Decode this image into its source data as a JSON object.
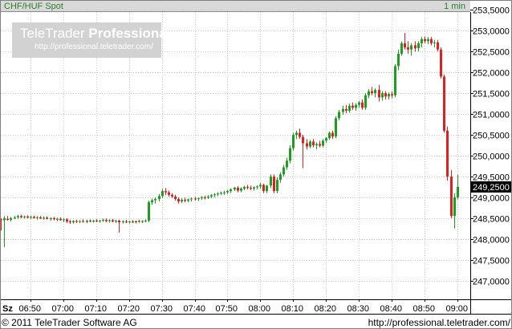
{
  "header": {
    "instrument": "CHF/HUF Spot",
    "interval": "1 min"
  },
  "watermark": {
    "brand_light": "TeleTrader",
    "brand_bold": "Professional",
    "url": "http://professional.teletrader.com/"
  },
  "footer": {
    "copyright": "© 2011 TeleTrader Software AG",
    "url": "http://professional.teletrader.com/"
  },
  "chart_data": {
    "type": "candlestick",
    "title": "CHF/HUF Spot",
    "interval": "1 min",
    "xlabel": "Sz",
    "ylabel": "",
    "ylim": [
      246.55,
      253.45
    ],
    "xlim": [
      "06:38",
      "09:02"
    ],
    "grid": true,
    "x_ticks": [
      "06:50",
      "07:00",
      "07:10",
      "07:20",
      "07:30",
      "07:40",
      "07:50",
      "08:00",
      "08:10",
      "08:20",
      "08:30",
      "08:40",
      "08:50",
      "09:00"
    ],
    "y_ticks": [
      "253,5000",
      "253,0000",
      "252,5000",
      "252,0000",
      "251,5000",
      "251,0000",
      "250,5000",
      "250,0000",
      "249,5000",
      "249,0000",
      "248,5000",
      "248,0000",
      "247,5000",
      "247,0000"
    ],
    "y_tick_values": [
      253.5,
      253.0,
      252.5,
      252.0,
      251.5,
      251.0,
      250.5,
      250.0,
      249.5,
      249.0,
      248.5,
      248.0,
      247.5,
      247.0
    ],
    "last_price": "249,2500",
    "last_price_value": 249.25,
    "up_color": "#1e9e1e",
    "down_color": "#e02020",
    "last_price_box_color": "#000000",
    "candles": [
      {
        "t": "06:38",
        "o": 248.55,
        "h": 248.6,
        "l": 248.5,
        "c": 248.53
      },
      {
        "t": "06:39",
        "o": 248.53,
        "h": 248.56,
        "l": 248.48,
        "c": 248.5
      },
      {
        "t": "06:40",
        "o": 248.5,
        "h": 248.55,
        "l": 248.46,
        "c": 248.47
      },
      {
        "t": "06:41",
        "o": 248.47,
        "h": 248.5,
        "l": 248.2,
        "c": 248.45
      },
      {
        "t": "06:42",
        "o": 248.45,
        "h": 248.55,
        "l": 247.8,
        "c": 248.5
      },
      {
        "t": "06:43",
        "o": 248.48,
        "h": 248.55,
        "l": 248.44,
        "c": 248.46
      },
      {
        "t": "06:44",
        "o": 248.46,
        "h": 248.53,
        "l": 248.42,
        "c": 248.5
      },
      {
        "t": "06:45",
        "o": 248.5,
        "h": 248.55,
        "l": 248.47,
        "c": 248.52
      },
      {
        "t": "06:46",
        "o": 248.52,
        "h": 248.58,
        "l": 248.48,
        "c": 248.55
      },
      {
        "t": "06:47",
        "o": 248.55,
        "h": 248.58,
        "l": 248.5,
        "c": 248.52
      },
      {
        "t": "06:48",
        "o": 248.52,
        "h": 248.56,
        "l": 248.49,
        "c": 248.54
      },
      {
        "t": "06:49",
        "o": 248.54,
        "h": 248.57,
        "l": 248.5,
        "c": 248.51
      },
      {
        "t": "06:50",
        "o": 248.51,
        "h": 248.56,
        "l": 248.48,
        "c": 248.53
      },
      {
        "t": "06:51",
        "o": 248.53,
        "h": 248.56,
        "l": 248.49,
        "c": 248.5
      },
      {
        "t": "06:52",
        "o": 248.5,
        "h": 248.55,
        "l": 248.46,
        "c": 248.52
      },
      {
        "t": "06:53",
        "o": 248.52,
        "h": 248.55,
        "l": 248.48,
        "c": 248.49
      },
      {
        "t": "06:54",
        "o": 248.49,
        "h": 248.54,
        "l": 248.46,
        "c": 248.51
      },
      {
        "t": "06:55",
        "o": 248.51,
        "h": 248.54,
        "l": 248.47,
        "c": 248.48
      },
      {
        "t": "06:56",
        "o": 248.48,
        "h": 248.52,
        "l": 248.44,
        "c": 248.5
      },
      {
        "t": "06:57",
        "o": 248.5,
        "h": 248.53,
        "l": 248.45,
        "c": 248.47
      },
      {
        "t": "06:58",
        "o": 248.47,
        "h": 248.51,
        "l": 248.43,
        "c": 248.48
      },
      {
        "t": "06:59",
        "o": 248.48,
        "h": 248.52,
        "l": 248.44,
        "c": 248.45
      },
      {
        "t": "07:00",
        "o": 248.45,
        "h": 248.5,
        "l": 248.4,
        "c": 248.47
      },
      {
        "t": "07:01",
        "o": 248.47,
        "h": 248.5,
        "l": 248.38,
        "c": 248.42
      },
      {
        "t": "07:02",
        "o": 248.42,
        "h": 248.46,
        "l": 248.36,
        "c": 248.4
      },
      {
        "t": "07:03",
        "o": 248.4,
        "h": 248.45,
        "l": 248.37,
        "c": 248.43
      },
      {
        "t": "07:04",
        "o": 248.43,
        "h": 248.46,
        "l": 248.38,
        "c": 248.41
      },
      {
        "t": "07:05",
        "o": 248.41,
        "h": 248.45,
        "l": 248.38,
        "c": 248.43
      },
      {
        "t": "07:06",
        "o": 248.43,
        "h": 248.47,
        "l": 248.39,
        "c": 248.41
      },
      {
        "t": "07:07",
        "o": 248.41,
        "h": 248.46,
        "l": 248.38,
        "c": 248.44
      },
      {
        "t": "07:08",
        "o": 248.44,
        "h": 248.47,
        "l": 248.4,
        "c": 248.42
      },
      {
        "t": "07:09",
        "o": 248.42,
        "h": 248.46,
        "l": 248.39,
        "c": 248.44
      },
      {
        "t": "07:10",
        "o": 248.44,
        "h": 248.48,
        "l": 248.4,
        "c": 248.42
      },
      {
        "t": "07:11",
        "o": 248.42,
        "h": 248.46,
        "l": 248.39,
        "c": 248.44
      },
      {
        "t": "07:12",
        "o": 248.44,
        "h": 248.49,
        "l": 248.41,
        "c": 248.46
      },
      {
        "t": "07:13",
        "o": 248.46,
        "h": 248.49,
        "l": 248.4,
        "c": 248.43
      },
      {
        "t": "07:14",
        "o": 248.43,
        "h": 248.47,
        "l": 248.39,
        "c": 248.45
      },
      {
        "t": "07:15",
        "o": 248.45,
        "h": 248.48,
        "l": 248.4,
        "c": 248.42
      },
      {
        "t": "07:16",
        "o": 248.42,
        "h": 248.46,
        "l": 248.38,
        "c": 248.44
      },
      {
        "t": "07:17",
        "o": 248.44,
        "h": 248.46,
        "l": 248.15,
        "c": 248.4
      },
      {
        "t": "07:18",
        "o": 248.4,
        "h": 248.45,
        "l": 248.37,
        "c": 248.42
      },
      {
        "t": "07:19",
        "o": 248.42,
        "h": 248.46,
        "l": 248.38,
        "c": 248.4
      },
      {
        "t": "07:20",
        "o": 248.4,
        "h": 248.44,
        "l": 248.37,
        "c": 248.42
      },
      {
        "t": "07:21",
        "o": 248.42,
        "h": 248.45,
        "l": 248.38,
        "c": 248.4
      },
      {
        "t": "07:22",
        "o": 248.4,
        "h": 248.44,
        "l": 248.37,
        "c": 248.43
      },
      {
        "t": "07:23",
        "o": 248.43,
        "h": 248.46,
        "l": 248.39,
        "c": 248.41
      },
      {
        "t": "07:24",
        "o": 248.41,
        "h": 248.45,
        "l": 248.38,
        "c": 248.43
      },
      {
        "t": "07:25",
        "o": 248.43,
        "h": 248.47,
        "l": 248.4,
        "c": 248.44
      },
      {
        "t": "07:26",
        "o": 248.44,
        "h": 248.92,
        "l": 248.4,
        "c": 248.88
      },
      {
        "t": "07:27",
        "o": 248.88,
        "h": 248.97,
        "l": 248.82,
        "c": 248.93
      },
      {
        "t": "07:28",
        "o": 248.93,
        "h": 249.0,
        "l": 248.85,
        "c": 248.96
      },
      {
        "t": "07:29",
        "o": 248.96,
        "h": 249.08,
        "l": 248.9,
        "c": 249.03
      },
      {
        "t": "07:30",
        "o": 249.03,
        "h": 249.2,
        "l": 248.98,
        "c": 249.15
      },
      {
        "t": "07:31",
        "o": 249.15,
        "h": 249.22,
        "l": 249.05,
        "c": 249.12
      },
      {
        "t": "07:32",
        "o": 249.12,
        "h": 249.16,
        "l": 249.02,
        "c": 249.06
      },
      {
        "t": "07:33",
        "o": 249.06,
        "h": 249.1,
        "l": 248.98,
        "c": 249.02
      },
      {
        "t": "07:34",
        "o": 249.02,
        "h": 249.06,
        "l": 248.92,
        "c": 248.96
      },
      {
        "t": "07:35",
        "o": 248.96,
        "h": 249.0,
        "l": 248.85,
        "c": 248.9
      },
      {
        "t": "07:36",
        "o": 248.9,
        "h": 248.98,
        "l": 248.86,
        "c": 248.94
      },
      {
        "t": "07:37",
        "o": 248.94,
        "h": 248.99,
        "l": 248.88,
        "c": 248.92
      },
      {
        "t": "07:38",
        "o": 248.92,
        "h": 248.97,
        "l": 248.88,
        "c": 248.95
      },
      {
        "t": "07:39",
        "o": 248.95,
        "h": 248.99,
        "l": 248.9,
        "c": 248.97
      },
      {
        "t": "07:40",
        "o": 248.97,
        "h": 249.01,
        "l": 248.92,
        "c": 248.96
      },
      {
        "t": "07:41",
        "o": 248.96,
        "h": 249.0,
        "l": 248.91,
        "c": 248.98
      },
      {
        "t": "07:42",
        "o": 248.98,
        "h": 249.03,
        "l": 248.94,
        "c": 249.0
      },
      {
        "t": "07:43",
        "o": 249.0,
        "h": 249.04,
        "l": 248.95,
        "c": 248.99
      },
      {
        "t": "07:44",
        "o": 248.99,
        "h": 249.05,
        "l": 248.96,
        "c": 249.02
      },
      {
        "t": "07:45",
        "o": 249.02,
        "h": 249.08,
        "l": 248.98,
        "c": 249.05
      },
      {
        "t": "07:46",
        "o": 249.05,
        "h": 249.1,
        "l": 249.0,
        "c": 249.07
      },
      {
        "t": "07:47",
        "o": 249.07,
        "h": 249.12,
        "l": 249.03,
        "c": 249.09
      },
      {
        "t": "07:48",
        "o": 249.09,
        "h": 249.14,
        "l": 249.05,
        "c": 249.11
      },
      {
        "t": "07:49",
        "o": 249.11,
        "h": 249.16,
        "l": 249.06,
        "c": 249.12
      },
      {
        "t": "07:50",
        "o": 249.12,
        "h": 249.18,
        "l": 249.08,
        "c": 249.15
      },
      {
        "t": "07:51",
        "o": 249.15,
        "h": 249.22,
        "l": 249.1,
        "c": 249.19
      },
      {
        "t": "07:52",
        "o": 249.19,
        "h": 249.25,
        "l": 249.15,
        "c": 249.23
      },
      {
        "t": "07:53",
        "o": 249.23,
        "h": 249.27,
        "l": 249.12,
        "c": 249.16
      },
      {
        "t": "07:54",
        "o": 249.16,
        "h": 249.24,
        "l": 249.12,
        "c": 249.21
      },
      {
        "t": "07:55",
        "o": 249.21,
        "h": 249.28,
        "l": 249.17,
        "c": 249.25
      },
      {
        "t": "07:56",
        "o": 249.25,
        "h": 249.3,
        "l": 249.19,
        "c": 249.23
      },
      {
        "t": "07:57",
        "o": 249.23,
        "h": 249.28,
        "l": 249.17,
        "c": 249.21
      },
      {
        "t": "07:58",
        "o": 249.21,
        "h": 249.26,
        "l": 249.16,
        "c": 249.24
      },
      {
        "t": "07:59",
        "o": 249.24,
        "h": 249.29,
        "l": 249.19,
        "c": 249.26
      },
      {
        "t": "08:00",
        "o": 249.26,
        "h": 249.35,
        "l": 249.2,
        "c": 249.3
      },
      {
        "t": "08:01",
        "o": 249.3,
        "h": 249.33,
        "l": 249.1,
        "c": 249.15
      },
      {
        "t": "08:02",
        "o": 249.15,
        "h": 249.3,
        "l": 249.1,
        "c": 249.28
      },
      {
        "t": "08:03",
        "o": 249.28,
        "h": 249.55,
        "l": 249.22,
        "c": 249.5
      },
      {
        "t": "08:04",
        "o": 249.5,
        "h": 249.55,
        "l": 249.1,
        "c": 249.15
      },
      {
        "t": "08:05",
        "o": 249.15,
        "h": 249.48,
        "l": 249.1,
        "c": 249.42
      },
      {
        "t": "08:06",
        "o": 249.42,
        "h": 249.6,
        "l": 249.35,
        "c": 249.55
      },
      {
        "t": "08:07",
        "o": 249.55,
        "h": 249.78,
        "l": 249.5,
        "c": 249.72
      },
      {
        "t": "08:08",
        "o": 249.72,
        "h": 249.95,
        "l": 249.66,
        "c": 249.88
      },
      {
        "t": "08:09",
        "o": 249.88,
        "h": 250.25,
        "l": 249.82,
        "c": 250.18
      },
      {
        "t": "08:10",
        "o": 250.18,
        "h": 250.55,
        "l": 250.12,
        "c": 250.5
      },
      {
        "t": "08:11",
        "o": 250.5,
        "h": 250.6,
        "l": 250.4,
        "c": 250.55
      },
      {
        "t": "08:12",
        "o": 250.55,
        "h": 250.65,
        "l": 250.4,
        "c": 250.45
      },
      {
        "t": "08:13",
        "o": 250.45,
        "h": 250.5,
        "l": 249.7,
        "c": 250.3
      },
      {
        "t": "08:14",
        "o": 250.3,
        "h": 250.4,
        "l": 250.15,
        "c": 250.22
      },
      {
        "t": "08:15",
        "o": 250.22,
        "h": 250.38,
        "l": 250.18,
        "c": 250.34
      },
      {
        "t": "08:16",
        "o": 250.34,
        "h": 250.4,
        "l": 250.2,
        "c": 250.25
      },
      {
        "t": "08:17",
        "o": 250.25,
        "h": 250.32,
        "l": 250.15,
        "c": 250.28
      },
      {
        "t": "08:18",
        "o": 250.28,
        "h": 250.36,
        "l": 250.2,
        "c": 250.24
      },
      {
        "t": "08:19",
        "o": 250.24,
        "h": 250.4,
        "l": 250.2,
        "c": 250.36
      },
      {
        "t": "08:20",
        "o": 250.36,
        "h": 250.45,
        "l": 250.3,
        "c": 250.42
      },
      {
        "t": "08:21",
        "o": 250.42,
        "h": 250.58,
        "l": 250.38,
        "c": 250.55
      },
      {
        "t": "08:22",
        "o": 250.55,
        "h": 250.6,
        "l": 250.4,
        "c": 250.46
      },
      {
        "t": "08:23",
        "o": 250.46,
        "h": 250.95,
        "l": 250.42,
        "c": 250.9
      },
      {
        "t": "08:24",
        "o": 250.9,
        "h": 251.1,
        "l": 250.85,
        "c": 251.05
      },
      {
        "t": "08:25",
        "o": 251.05,
        "h": 251.2,
        "l": 250.98,
        "c": 251.12
      },
      {
        "t": "08:26",
        "o": 251.12,
        "h": 251.22,
        "l": 251.02,
        "c": 251.08
      },
      {
        "t": "08:27",
        "o": 251.08,
        "h": 251.25,
        "l": 251.03,
        "c": 251.2
      },
      {
        "t": "08:28",
        "o": 251.2,
        "h": 251.28,
        "l": 251.1,
        "c": 251.15
      },
      {
        "t": "08:29",
        "o": 251.15,
        "h": 251.26,
        "l": 251.08,
        "c": 251.22
      },
      {
        "t": "08:30",
        "o": 251.22,
        "h": 251.32,
        "l": 251.15,
        "c": 251.28
      },
      {
        "t": "08:31",
        "o": 251.28,
        "h": 251.35,
        "l": 251.1,
        "c": 251.15
      },
      {
        "t": "08:32",
        "o": 251.15,
        "h": 251.5,
        "l": 251.1,
        "c": 251.45
      },
      {
        "t": "08:33",
        "o": 251.45,
        "h": 251.6,
        "l": 251.38,
        "c": 251.55
      },
      {
        "t": "08:34",
        "o": 251.55,
        "h": 251.65,
        "l": 251.45,
        "c": 251.5
      },
      {
        "t": "08:35",
        "o": 251.5,
        "h": 251.62,
        "l": 251.4,
        "c": 251.58
      },
      {
        "t": "08:36",
        "o": 251.58,
        "h": 251.7,
        "l": 251.3,
        "c": 251.4
      },
      {
        "t": "08:37",
        "o": 251.4,
        "h": 251.55,
        "l": 251.32,
        "c": 251.5
      },
      {
        "t": "08:38",
        "o": 251.5,
        "h": 251.55,
        "l": 251.35,
        "c": 251.42
      },
      {
        "t": "08:39",
        "o": 251.42,
        "h": 251.52,
        "l": 251.35,
        "c": 251.48
      },
      {
        "t": "08:40",
        "o": 251.48,
        "h": 251.55,
        "l": 251.38,
        "c": 251.45
      },
      {
        "t": "08:41",
        "o": 251.45,
        "h": 252.2,
        "l": 251.4,
        "c": 252.15
      },
      {
        "t": "08:42",
        "o": 252.15,
        "h": 252.55,
        "l": 252.05,
        "c": 252.45
      },
      {
        "t": "08:43",
        "o": 252.45,
        "h": 252.75,
        "l": 252.4,
        "c": 252.7
      },
      {
        "t": "08:44",
        "o": 252.7,
        "h": 252.95,
        "l": 252.55,
        "c": 252.6
      },
      {
        "t": "08:45",
        "o": 252.6,
        "h": 252.75,
        "l": 252.45,
        "c": 252.55
      },
      {
        "t": "08:46",
        "o": 252.55,
        "h": 252.7,
        "l": 252.4,
        "c": 252.65
      },
      {
        "t": "08:47",
        "o": 252.65,
        "h": 252.75,
        "l": 252.5,
        "c": 252.58
      },
      {
        "t": "08:48",
        "o": 252.58,
        "h": 252.75,
        "l": 252.5,
        "c": 252.7
      },
      {
        "t": "08:49",
        "o": 252.7,
        "h": 252.85,
        "l": 252.6,
        "c": 252.8
      },
      {
        "t": "08:50",
        "o": 252.8,
        "h": 252.86,
        "l": 252.7,
        "c": 252.75
      },
      {
        "t": "08:51",
        "o": 252.75,
        "h": 252.85,
        "l": 252.68,
        "c": 252.8
      },
      {
        "t": "08:52",
        "o": 252.8,
        "h": 252.85,
        "l": 252.65,
        "c": 252.7
      },
      {
        "t": "08:53",
        "o": 252.7,
        "h": 252.78,
        "l": 252.6,
        "c": 252.72
      },
      {
        "t": "08:54",
        "o": 252.72,
        "h": 252.78,
        "l": 252.5,
        "c": 252.55
      },
      {
        "t": "08:55",
        "o": 252.55,
        "h": 252.6,
        "l": 251.85,
        "c": 251.9
      },
      {
        "t": "08:56",
        "o": 251.9,
        "h": 251.95,
        "l": 250.55,
        "c": 250.6
      },
      {
        "t": "08:57",
        "o": 250.6,
        "h": 250.7,
        "l": 249.4,
        "c": 249.5
      },
      {
        "t": "08:58",
        "o": 249.5,
        "h": 249.65,
        "l": 248.5,
        "c": 248.55
      },
      {
        "t": "08:59",
        "o": 248.55,
        "h": 249.1,
        "l": 248.25,
        "c": 249.0
      },
      {
        "t": "09:00",
        "o": 249.0,
        "h": 249.55,
        "l": 248.95,
        "c": 249.25
      }
    ]
  }
}
